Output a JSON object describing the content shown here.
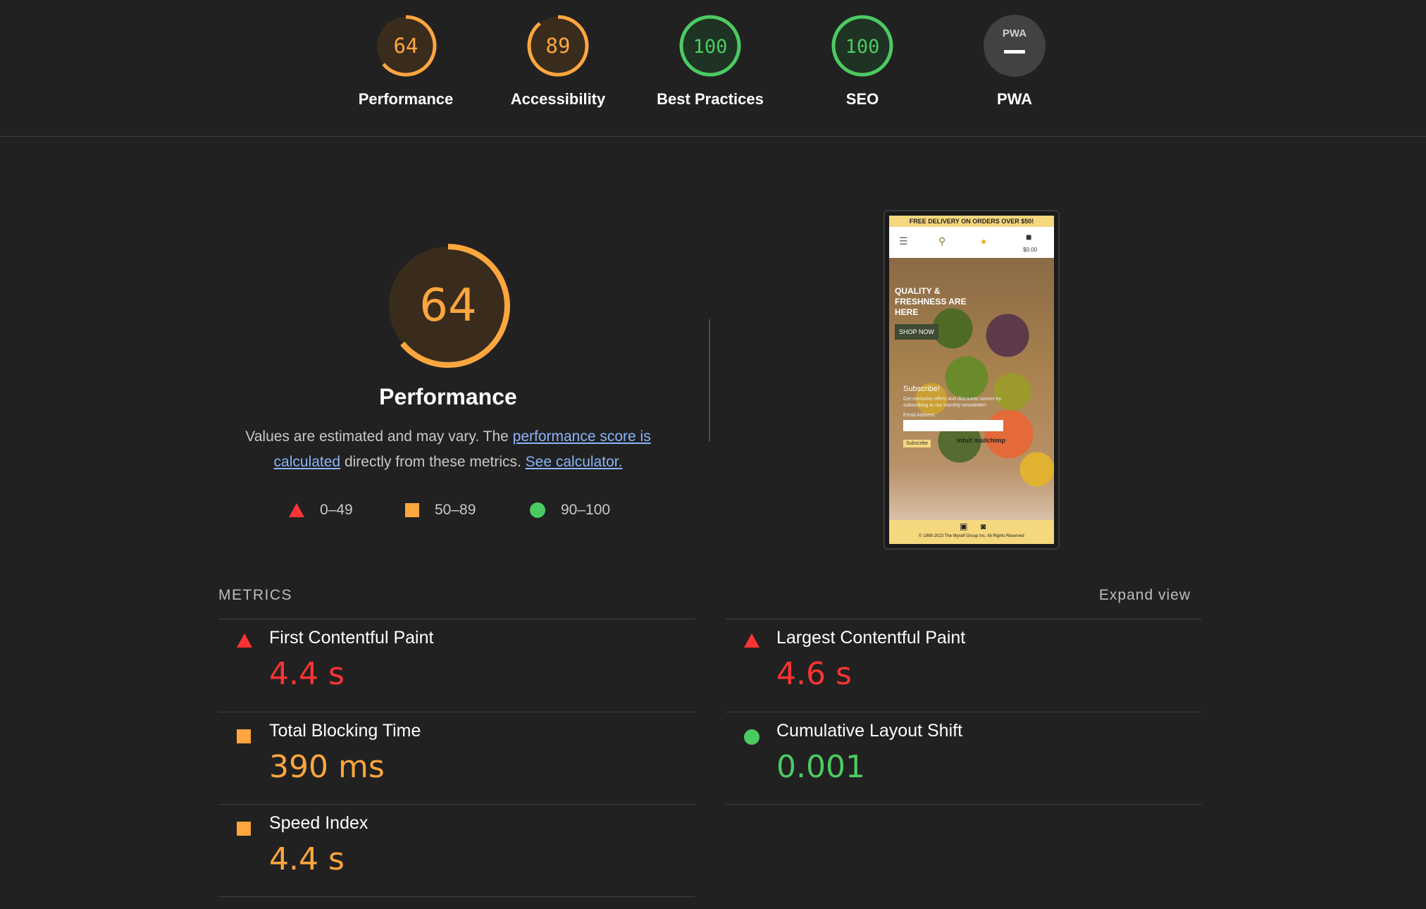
{
  "gauges": [
    {
      "label": "Performance",
      "score": "64",
      "value": 64,
      "color": "#ffa63f",
      "bg": "#3a2c1c"
    },
    {
      "label": "Accessibility",
      "score": "89",
      "value": 89,
      "color": "#ffa63f",
      "bg": "#3a2c1c"
    },
    {
      "label": "Best Practices",
      "score": "100",
      "value": 100,
      "color": "#4cca62",
      "bg": "#1f3324"
    },
    {
      "label": "SEO",
      "score": "100",
      "value": 100,
      "color": "#4cca62",
      "bg": "#1f3324"
    },
    {
      "label": "PWA",
      "badge": "PWA",
      "color": "#9e9e9e",
      "bg": "#424242"
    }
  ],
  "performance": {
    "score": "64",
    "value": 64,
    "title": "Performance",
    "desc_prefix": "Values are estimated and may vary. The ",
    "desc_link1": "performance score is calculated",
    "desc_mid": " directly from these metrics. ",
    "desc_link2": "See calculator."
  },
  "legend": {
    "fail": "0–49",
    "average": "50–89",
    "pass": "90–100"
  },
  "thumbnail": {
    "banner": "FREE DELIVERY ON ORDERS OVER $50!",
    "cart_price": "$0.00",
    "hero_title": "QUALITY & FRESHNESS ARE HERE",
    "shop_button": "SHOP NOW",
    "subscribe_title": "Subscribe!",
    "subscribe_text": "Get exclusive offers and discounts sooner by subscribing to our monthly newsletter!",
    "email_label": "Email Address",
    "subscribe_button": "Subscribe",
    "mailchimp": "intuit mailchimp",
    "copyright": "© 1988-2023 The Myself Group Inc. All Rights Reserved"
  },
  "metrics": {
    "header": "METRICS",
    "expand": "Expand view",
    "items": [
      {
        "name": "First Contentful Paint",
        "value": "4.4 s",
        "rating": "fail"
      },
      {
        "name": "Largest Contentful Paint",
        "value": "4.6 s",
        "rating": "fail"
      },
      {
        "name": "Total Blocking Time",
        "value": "390 ms",
        "rating": "average"
      },
      {
        "name": "Cumulative Layout Shift",
        "value": "0.001",
        "rating": "pass"
      },
      {
        "name": "Speed Index",
        "value": "4.4 s",
        "rating": "average"
      }
    ]
  },
  "colors": {
    "fail": "#ff3333",
    "average": "#ffa63f",
    "pass": "#4cca62",
    "link": "#8ab4f8"
  }
}
